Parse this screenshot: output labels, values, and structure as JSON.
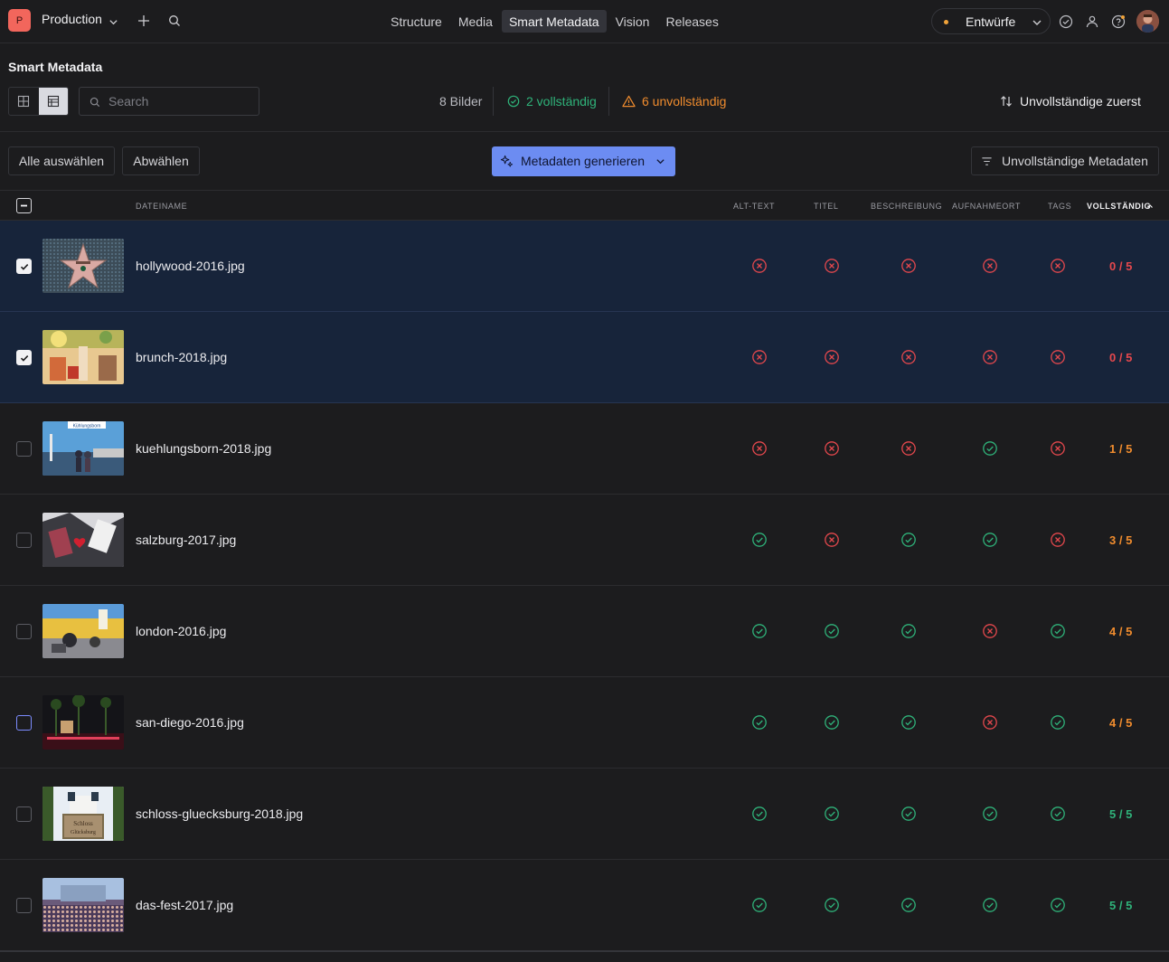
{
  "topnav": {
    "brand_initial": "P",
    "workspace": "Production",
    "tabs": [
      {
        "label": "Structure"
      },
      {
        "label": "Media"
      },
      {
        "label": "Smart Metadata",
        "active": true
      },
      {
        "label": "Vision"
      },
      {
        "label": "Releases"
      }
    ],
    "version_label": "Entwürfe",
    "version_dot_color": "#f0a33a"
  },
  "header": {
    "title": "Smart Metadata",
    "search_placeholder": "Search",
    "count_label": "8 Bilder",
    "complete_label": "2 vollständig",
    "incomplete_label": "6 unvollständig",
    "sort_label": "Unvollständige zuerst"
  },
  "actions": {
    "select_all": "Alle auswählen",
    "deselect": "Abwählen",
    "generate": "Metadaten generieren",
    "filter": "Unvollständige Metadaten"
  },
  "table": {
    "columns": {
      "filename": "DATEINAME",
      "alt": "ALT-TEXT",
      "title": "TITEL",
      "description": "BESCHREIBUNG",
      "location": "AUFNAHMEORT",
      "tags": "TAGS",
      "complete": "VOLLSTÄNDIG"
    },
    "rows": [
      {
        "filename": "hollywood-2016.jpg",
        "selected": true,
        "status": [
          false,
          false,
          false,
          false,
          false
        ],
        "score": "0 / 5",
        "thumb": "hollywood"
      },
      {
        "filename": "brunch-2018.jpg",
        "selected": true,
        "status": [
          false,
          false,
          false,
          false,
          false
        ],
        "score": "0 / 5",
        "thumb": "brunch"
      },
      {
        "filename": "kuehlungsborn-2018.jpg",
        "selected": false,
        "status": [
          false,
          false,
          false,
          true,
          false
        ],
        "score": "1 / 5",
        "thumb": "kuehlungsborn",
        "thumb_sign": "Kühlungsborn"
      },
      {
        "filename": "salzburg-2017.jpg",
        "selected": false,
        "status": [
          true,
          false,
          true,
          true,
          false
        ],
        "score": "3 / 5",
        "thumb": "salzburg"
      },
      {
        "filename": "london-2016.jpg",
        "selected": false,
        "status": [
          true,
          true,
          true,
          false,
          true
        ],
        "score": "4 / 5",
        "thumb": "london"
      },
      {
        "filename": "san-diego-2016.jpg",
        "selected": false,
        "focused": true,
        "status": [
          true,
          true,
          true,
          false,
          true
        ],
        "score": "4 / 5",
        "thumb": "sandiego"
      },
      {
        "filename": "schloss-gluecksburg-2018.jpg",
        "selected": false,
        "status": [
          true,
          true,
          true,
          true,
          true
        ],
        "score": "5 / 5",
        "thumb": "schloss",
        "thumb_sign": "Schloss Glücksburg"
      },
      {
        "filename": "das-fest-2017.jpg",
        "selected": false,
        "status": [
          true,
          true,
          true,
          true,
          true
        ],
        "score": "5 / 5",
        "thumb": "fest"
      }
    ]
  },
  "colors": {
    "ok": "#2fb37a",
    "missing": "#e5484d",
    "partial": "#f08c2e",
    "primary": "#6c8cf2"
  }
}
